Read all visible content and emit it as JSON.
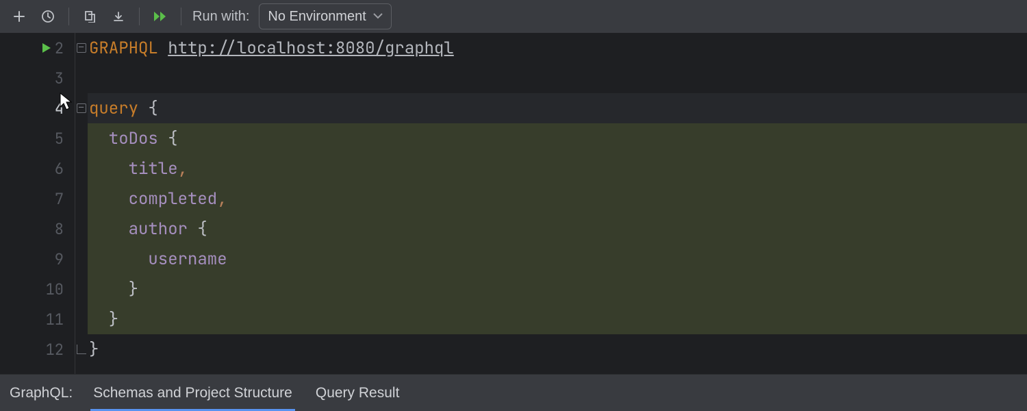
{
  "toolbar": {
    "run_with_label": "Run with:",
    "env_selected": "No Environment"
  },
  "editor": {
    "lines": {
      "l2_method": "GRAPHQL",
      "l2_url": "http://localhost:8080/graphql",
      "l4_a": "query",
      "l4_b": " {",
      "l5_a": "  toDos",
      "l5_b": " {",
      "l6_a": "    title",
      "l6_b": ",",
      "l7_a": "    completed",
      "l7_b": ",",
      "l8_a": "    author",
      "l8_b": " {",
      "l9_a": "      username",
      "l10": "    }",
      "l11": "  }",
      "l12": "}"
    },
    "line_numbers": [
      "2",
      "3",
      "4",
      "5",
      "6",
      "7",
      "8",
      "9",
      "10",
      "11",
      "12"
    ],
    "current_line": "4"
  },
  "bottom": {
    "panel_label": "GraphQL:",
    "tab_schemas": "Schemas and Project Structure",
    "tab_result": "Query Result"
  }
}
